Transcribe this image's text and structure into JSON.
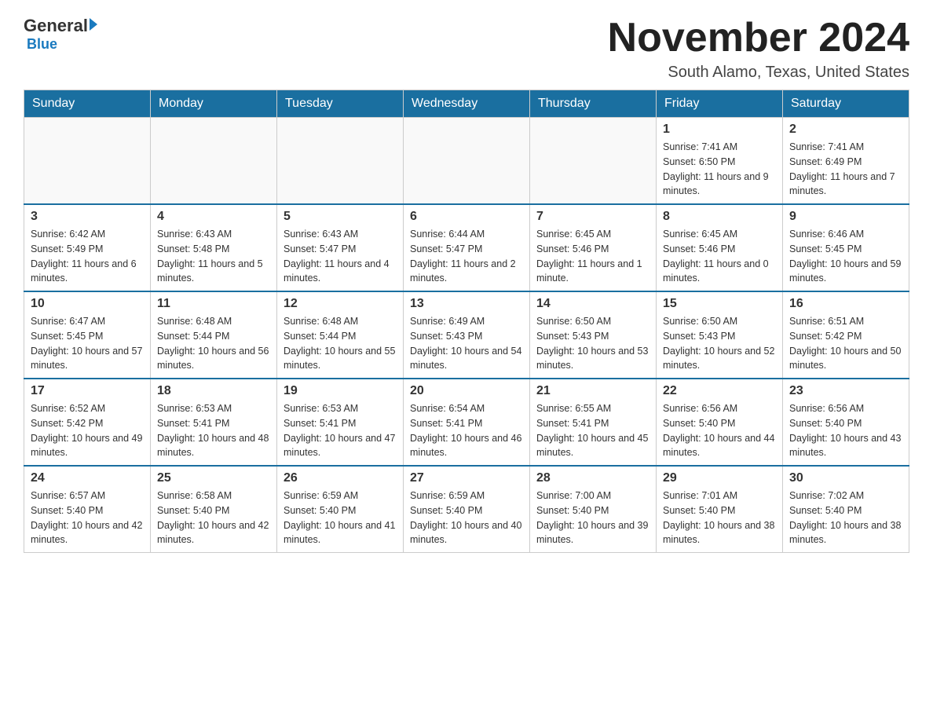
{
  "header": {
    "logo_general": "General",
    "logo_blue": "Blue",
    "month_title": "November 2024",
    "location": "South Alamo, Texas, United States"
  },
  "days_of_week": [
    "Sunday",
    "Monday",
    "Tuesday",
    "Wednesday",
    "Thursday",
    "Friday",
    "Saturday"
  ],
  "weeks": [
    [
      {
        "day": "",
        "info": ""
      },
      {
        "day": "",
        "info": ""
      },
      {
        "day": "",
        "info": ""
      },
      {
        "day": "",
        "info": ""
      },
      {
        "day": "",
        "info": ""
      },
      {
        "day": "1",
        "info": "Sunrise: 7:41 AM\nSunset: 6:50 PM\nDaylight: 11 hours and 9 minutes."
      },
      {
        "day": "2",
        "info": "Sunrise: 7:41 AM\nSunset: 6:49 PM\nDaylight: 11 hours and 7 minutes."
      }
    ],
    [
      {
        "day": "3",
        "info": "Sunrise: 6:42 AM\nSunset: 5:49 PM\nDaylight: 11 hours and 6 minutes."
      },
      {
        "day": "4",
        "info": "Sunrise: 6:43 AM\nSunset: 5:48 PM\nDaylight: 11 hours and 5 minutes."
      },
      {
        "day": "5",
        "info": "Sunrise: 6:43 AM\nSunset: 5:47 PM\nDaylight: 11 hours and 4 minutes."
      },
      {
        "day": "6",
        "info": "Sunrise: 6:44 AM\nSunset: 5:47 PM\nDaylight: 11 hours and 2 minutes."
      },
      {
        "day": "7",
        "info": "Sunrise: 6:45 AM\nSunset: 5:46 PM\nDaylight: 11 hours and 1 minute."
      },
      {
        "day": "8",
        "info": "Sunrise: 6:45 AM\nSunset: 5:46 PM\nDaylight: 11 hours and 0 minutes."
      },
      {
        "day": "9",
        "info": "Sunrise: 6:46 AM\nSunset: 5:45 PM\nDaylight: 10 hours and 59 minutes."
      }
    ],
    [
      {
        "day": "10",
        "info": "Sunrise: 6:47 AM\nSunset: 5:45 PM\nDaylight: 10 hours and 57 minutes."
      },
      {
        "day": "11",
        "info": "Sunrise: 6:48 AM\nSunset: 5:44 PM\nDaylight: 10 hours and 56 minutes."
      },
      {
        "day": "12",
        "info": "Sunrise: 6:48 AM\nSunset: 5:44 PM\nDaylight: 10 hours and 55 minutes."
      },
      {
        "day": "13",
        "info": "Sunrise: 6:49 AM\nSunset: 5:43 PM\nDaylight: 10 hours and 54 minutes."
      },
      {
        "day": "14",
        "info": "Sunrise: 6:50 AM\nSunset: 5:43 PM\nDaylight: 10 hours and 53 minutes."
      },
      {
        "day": "15",
        "info": "Sunrise: 6:50 AM\nSunset: 5:43 PM\nDaylight: 10 hours and 52 minutes."
      },
      {
        "day": "16",
        "info": "Sunrise: 6:51 AM\nSunset: 5:42 PM\nDaylight: 10 hours and 50 minutes."
      }
    ],
    [
      {
        "day": "17",
        "info": "Sunrise: 6:52 AM\nSunset: 5:42 PM\nDaylight: 10 hours and 49 minutes."
      },
      {
        "day": "18",
        "info": "Sunrise: 6:53 AM\nSunset: 5:41 PM\nDaylight: 10 hours and 48 minutes."
      },
      {
        "day": "19",
        "info": "Sunrise: 6:53 AM\nSunset: 5:41 PM\nDaylight: 10 hours and 47 minutes."
      },
      {
        "day": "20",
        "info": "Sunrise: 6:54 AM\nSunset: 5:41 PM\nDaylight: 10 hours and 46 minutes."
      },
      {
        "day": "21",
        "info": "Sunrise: 6:55 AM\nSunset: 5:41 PM\nDaylight: 10 hours and 45 minutes."
      },
      {
        "day": "22",
        "info": "Sunrise: 6:56 AM\nSunset: 5:40 PM\nDaylight: 10 hours and 44 minutes."
      },
      {
        "day": "23",
        "info": "Sunrise: 6:56 AM\nSunset: 5:40 PM\nDaylight: 10 hours and 43 minutes."
      }
    ],
    [
      {
        "day": "24",
        "info": "Sunrise: 6:57 AM\nSunset: 5:40 PM\nDaylight: 10 hours and 42 minutes."
      },
      {
        "day": "25",
        "info": "Sunrise: 6:58 AM\nSunset: 5:40 PM\nDaylight: 10 hours and 42 minutes."
      },
      {
        "day": "26",
        "info": "Sunrise: 6:59 AM\nSunset: 5:40 PM\nDaylight: 10 hours and 41 minutes."
      },
      {
        "day": "27",
        "info": "Sunrise: 6:59 AM\nSunset: 5:40 PM\nDaylight: 10 hours and 40 minutes."
      },
      {
        "day": "28",
        "info": "Sunrise: 7:00 AM\nSunset: 5:40 PM\nDaylight: 10 hours and 39 minutes."
      },
      {
        "day": "29",
        "info": "Sunrise: 7:01 AM\nSunset: 5:40 PM\nDaylight: 10 hours and 38 minutes."
      },
      {
        "day": "30",
        "info": "Sunrise: 7:02 AM\nSunset: 5:40 PM\nDaylight: 10 hours and 38 minutes."
      }
    ]
  ]
}
